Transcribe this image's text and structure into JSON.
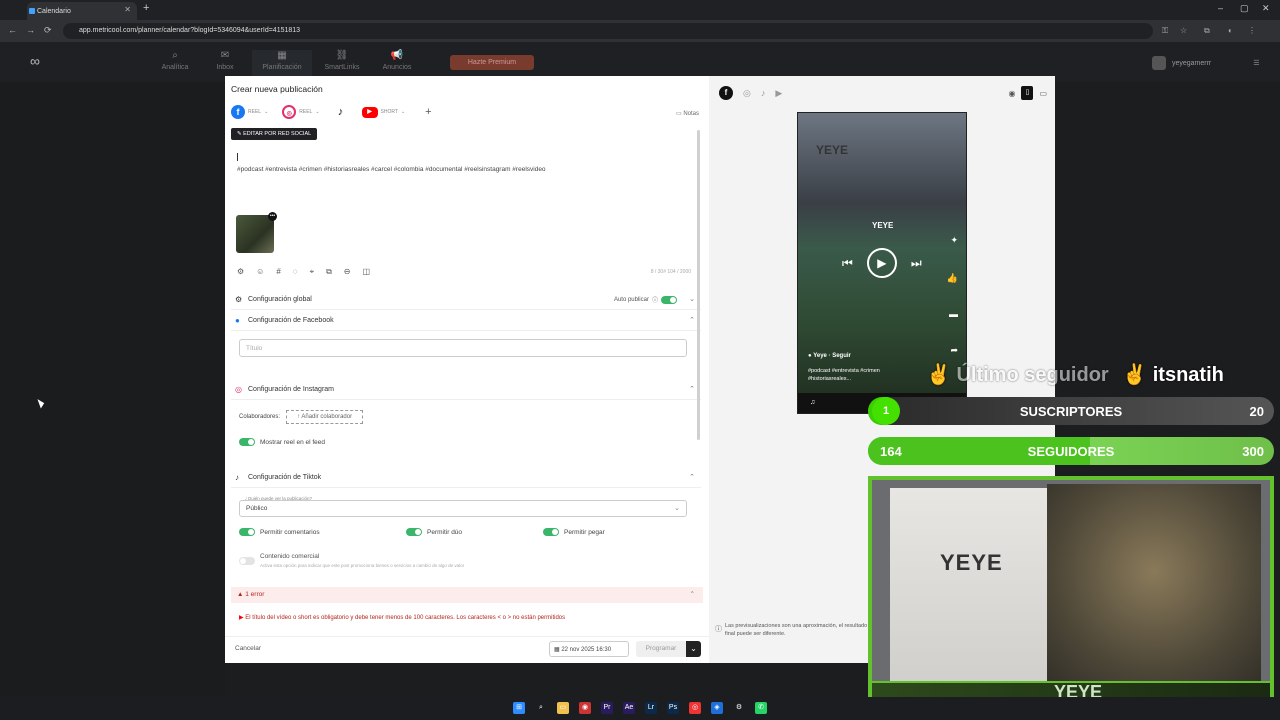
{
  "browser": {
    "tab_title": "Calendario",
    "url": "app.metricool.com/planner/calendar?blogId=5346094&userId=4151813",
    "new_tab": "+",
    "minimize": "–",
    "maximize": "▢",
    "close": "✕"
  },
  "app_nav": {
    "items": [
      {
        "label": "Analítica",
        "icon": "⌕"
      },
      {
        "label": "Inbox",
        "icon": "✉"
      },
      {
        "label": "Planificación",
        "icon": "▦"
      },
      {
        "label": "SmartLinks",
        "icon": "⛓"
      },
      {
        "label": "Anuncios",
        "icon": "📢"
      }
    ],
    "premium_button": "Hazte Premium",
    "user_name": "yeyegamerrr"
  },
  "modal": {
    "title": "Crear nueva publicación",
    "networks": [
      {
        "name": "facebook",
        "tag": "REEL"
      },
      {
        "name": "instagram",
        "tag": "REEL"
      },
      {
        "name": "tiktok",
        "tag": ""
      },
      {
        "name": "youtube",
        "tag": "SHORT"
      }
    ],
    "add_network": "+",
    "notes_label": "Notas",
    "edit_by_network": "EDITAR POR RED SOCIAL",
    "hashtags": "#podcast #entrevista #crimen #historiasreales #carcel #colombia #documental #reelsinstagram #reelsvideo",
    "counts": "8 / 30#   104 / 2000",
    "sections": {
      "global": "Configuración global",
      "auto_publish": "Auto publicar",
      "facebook": "Configuración de Facebook",
      "title_placeholder": "Título",
      "instagram": "Configuración de Instagram",
      "collaborators_label": "Colaboradores:",
      "add_collaborator": "Añadir colaborador",
      "show_reel": "Mostrar reel en el feed",
      "tiktok": "Configuración de Tiktok",
      "who_can_see": "¿Quién puede ver la publicación?",
      "visibility_value": "Público",
      "allow_comments": "Permitir comentarios",
      "allow_duo": "Permitir dúo",
      "allow_stitch": "Permitir pegar",
      "commercial_content": "Contenido comercial",
      "commercial_desc": "Activa esta opción para indicar que este post promociona bienes o servicios a cambio de algo de valor"
    },
    "error": {
      "heading": "1 error",
      "message": "El título del vídeo o short es obligatorio y debe tener menos de 100 caracteres. Los caracteres < o > no están permitidos"
    },
    "footer": {
      "cancel": "Cancelar",
      "date": "22 nov 2025 16:30",
      "program": "Programar"
    }
  },
  "preview": {
    "video_brand": "YEYE",
    "username": "Yeye",
    "follow": "Seguir",
    "caption": "#podcast #entrevista #crimen #historiasreales...",
    "note": "Las previsualizaciones son una aproximación, el resultado final puede ser diferente."
  },
  "overlay": {
    "last_follower_label": "Último seguidor",
    "last_follower_name": "itsnatih",
    "subs_current": "1",
    "subs_label": "SUSCRIPTORES",
    "subs_goal": "20",
    "subs_progress": 0.05,
    "followers_current": "164",
    "followers_label": "SEGUIDORES",
    "followers_goal": "300",
    "followers_progress": 0.547,
    "cam_tag": "YEYE",
    "wall_text": "YEYE"
  },
  "colors": {
    "facebook": "#1877f2",
    "instagram": "#e1306c",
    "youtube": "#ff0000",
    "toggle_on": "#3bb56a",
    "error": "#b3261e",
    "overlay_green": "#43e000"
  }
}
